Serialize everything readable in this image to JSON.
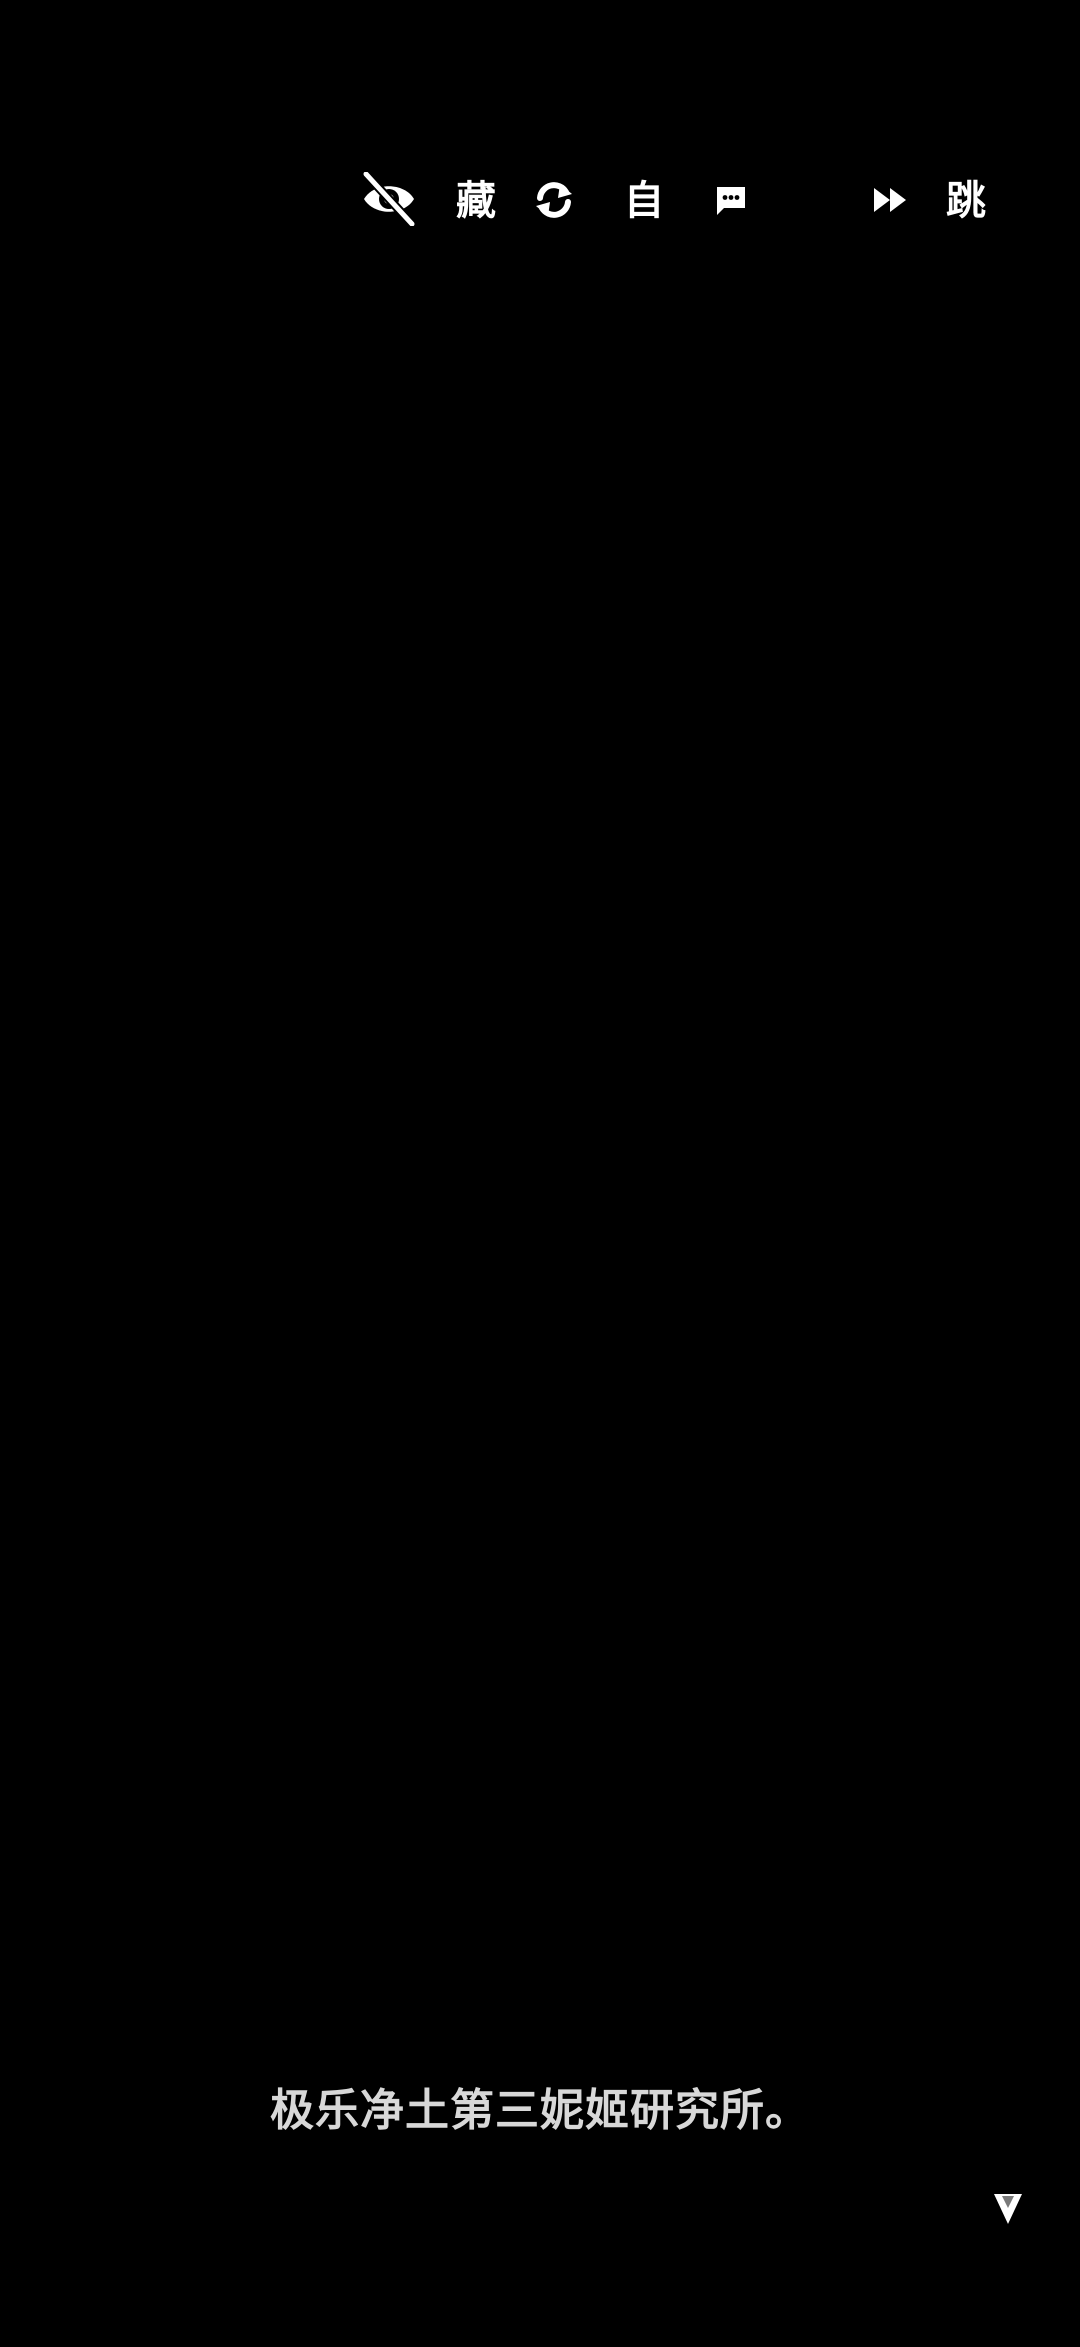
{
  "toolbar": {
    "hide": {
      "icon": "eye-off-icon",
      "label": "藏"
    },
    "auto": {
      "icon": "refresh-icon",
      "label": "自"
    },
    "log": {
      "icon": "message-icon"
    },
    "skip": {
      "icon": "fast-forward-icon",
      "label": "跳"
    }
  },
  "dialogue": {
    "text": "极乐净土第三妮姬研究所。"
  },
  "advance": {
    "icon": "down-triangle-icon"
  },
  "colors": {
    "background": "#000000",
    "icon": "#ffffff",
    "dialogue_text": "#d8d8d8"
  }
}
